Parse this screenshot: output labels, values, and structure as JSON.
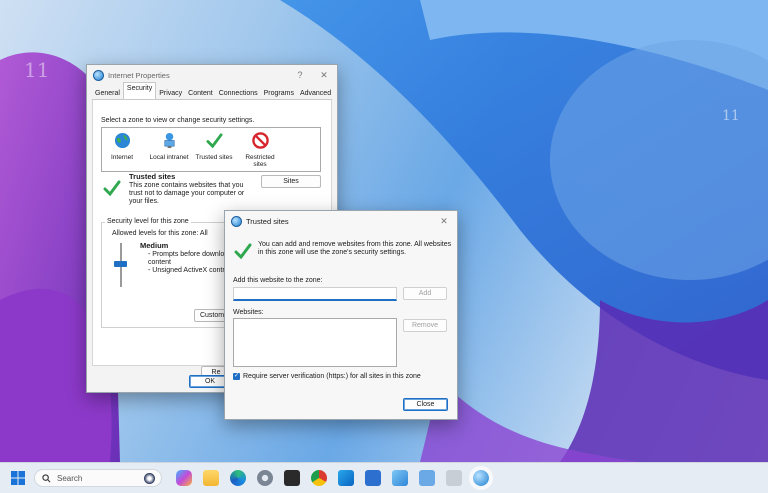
{
  "internet_properties": {
    "title": "Internet Properties",
    "help": "?",
    "close": "✕",
    "tabs": [
      "General",
      "Security",
      "Privacy",
      "Content",
      "Connections",
      "Programs",
      "Advanced"
    ],
    "zone_prompt": "Select a zone to view or change security settings.",
    "zones": [
      {
        "label": "Internet",
        "icon": "globe-icon"
      },
      {
        "label": "Local intranet",
        "icon": "network-icon"
      },
      {
        "label": "Trusted sites",
        "icon": "checkmark-icon"
      },
      {
        "label": "Restricted sites",
        "icon": "no-entry-icon"
      }
    ],
    "zone_heading": "Trusted sites",
    "zone_description": "This zone contains websites that you trust not to damage your computer or your files.",
    "sites_button": "Sites",
    "security_level_group": "Security level for this zone",
    "allowed_levels": "Allowed levels for this zone: All",
    "level_name": "Medium",
    "level_bullets": [
      "- Prompts before download",
      "content",
      "- Unsigned ActiveX control"
    ],
    "custom_button": "Custom",
    "reset_button": "Re",
    "ok_button": "OK"
  },
  "trusted_sites": {
    "title": "Trusted sites",
    "close": "✕",
    "info": "You can add and remove websites from this zone. All websites in this zone will use the zone's security settings.",
    "add_label": "Add this website to the zone:",
    "add_value": "",
    "add_button": "Add",
    "websites_label": "Websites:",
    "remove_button": "Remove",
    "require_https": "Require server verification (https:) for all sites in this zone",
    "require_https_checked": true,
    "close_button": "Close"
  },
  "desktop": {
    "clock_numerals": [
      "11",
      "11"
    ]
  },
  "taskbar": {
    "search_placeholder": "Search",
    "apps": [
      "windows-start-icon",
      "copilot-icon",
      "file-explorer-icon",
      "edge-icon",
      "settings-icon",
      "terminal-icon",
      "chrome-icon",
      "outlook-icon",
      "store-icon",
      "photos-icon",
      "notepad-icon",
      "snipping-tool-icon",
      "internet-properties-icon"
    ]
  },
  "colors": {
    "accent": "#1f6fc4",
    "check_green": "#2fa84f",
    "restricted_red": "#d6242d"
  }
}
